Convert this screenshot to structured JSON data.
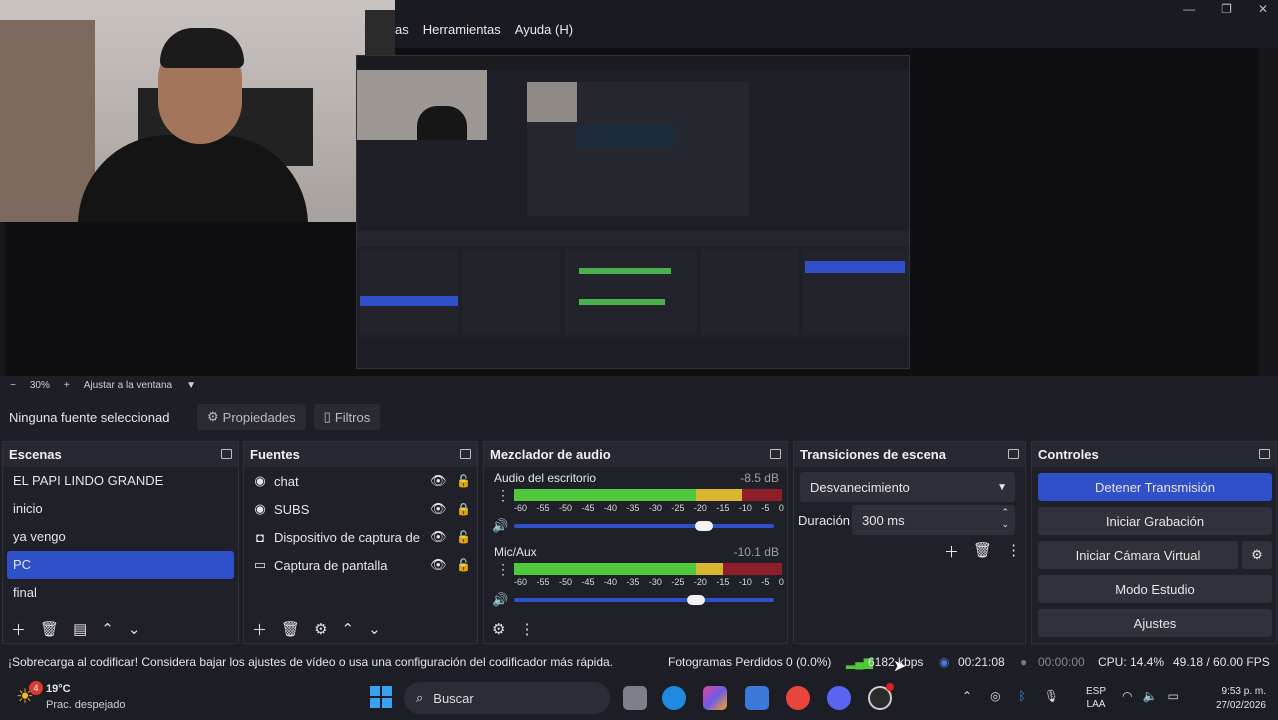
{
  "menu": [
    "as",
    "Herramientas",
    "Ayuda (H)"
  ],
  "window_controls": [
    "—",
    "❐",
    "✕"
  ],
  "zoom": {
    "minus": "−",
    "level": "30%",
    "plus": "+",
    "fit": "Ajustar a la ventana"
  },
  "source_toolbar": {
    "none": "Ninguna fuente seleccionad",
    "properties": "Propiedades",
    "filters": "Filtros"
  },
  "scenes": {
    "title": "Escenas",
    "items": [
      "EL PAPI LINDO GRANDE",
      "inicio",
      "ya vengo",
      "PC",
      "final"
    ],
    "selected": 3
  },
  "sources": {
    "title": "Fuentes",
    "items": [
      {
        "icon": "globe-icon",
        "glyph": "◉",
        "name": "chat",
        "locked": false
      },
      {
        "icon": "globe-icon",
        "glyph": "◉",
        "name": "SUBS",
        "locked": true
      },
      {
        "icon": "camera-icon",
        "glyph": "◘",
        "name": "Dispositivo de captura de v",
        "locked": false
      },
      {
        "icon": "monitor-icon",
        "glyph": "▭",
        "name": "Captura de pantalla",
        "locked": false
      }
    ]
  },
  "mixer": {
    "title": "Mezclador de audio",
    "channels": [
      {
        "name": "Audio del escritorio",
        "db": "-8.5 dB",
        "level": 0.85,
        "volume": 0.73
      },
      {
        "name": "Mic/Aux",
        "db": "-10.1 dB",
        "level": 0.78,
        "volume": 0.7
      }
    ],
    "scale": [
      "-60",
      "-55",
      "-50",
      "-45",
      "-40",
      "-35",
      "-30",
      "-25",
      "-20",
      "-15",
      "-10",
      "-5",
      "0"
    ]
  },
  "transitions": {
    "title": "Transiciones de escena",
    "type": "Desvanecimiento",
    "duration_label": "Duración",
    "duration": "300 ms"
  },
  "controls": {
    "title": "Controles",
    "buttons": [
      "Detener Transmisión",
      "Iniciar Grabación",
      "Iniciar Cámara Virtual",
      "Modo Estudio",
      "Ajustes"
    ]
  },
  "status": {
    "warning": "¡Sobrecarga al codificar! Considera bajar los ajustes de vídeo o usa una configuración del codificador más rápida.",
    "dropped": "Fotogramas Perdidos 0 (0.0%)",
    "bitrate": "6182 kbps",
    "stream_time": "00:21:08",
    "rec_time": "00:00:00",
    "cpu": "CPU: 14.4%",
    "fps": "49.18 / 60.00 FPS"
  },
  "taskbar": {
    "weather_temp": "19°C",
    "weather_desc": "Prac. despejado",
    "weather_badge": "4",
    "search": "Buscar",
    "lang_top": "ESP",
    "lang_bottom": "LAA",
    "time": "9:53 p. m.",
    "date": "27/02/2026"
  },
  "colors": {
    "accent": "#2f50c8",
    "meter_green": "#4fc93b",
    "meter_yellow": "#d7b52c",
    "meter_red": "#8e1f29"
  }
}
